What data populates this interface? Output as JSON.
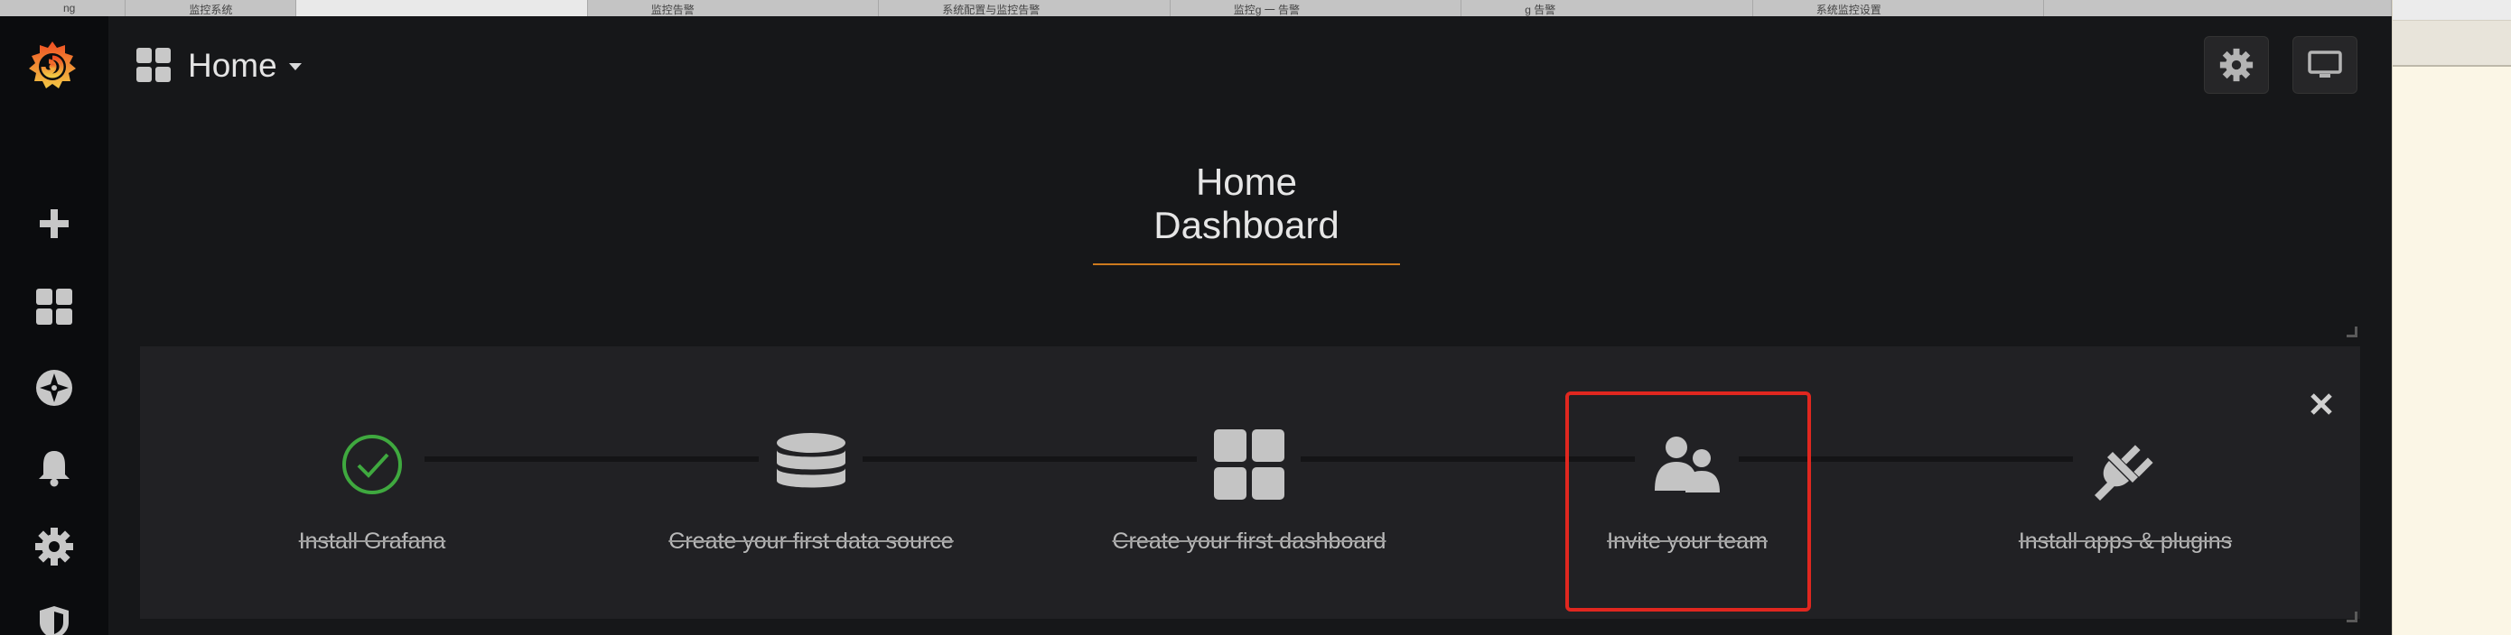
{
  "browser": {
    "tabs": [
      {
        "label": "ng"
      },
      {
        "label": "监控系统"
      },
      {
        "label": ""
      },
      {
        "label": "监控告警"
      },
      {
        "label": "系统配置与监控告警"
      },
      {
        "label": "监控g  一  告警"
      },
      {
        "label": "g    告警"
      },
      {
        "label": "系统监控设置"
      },
      {
        "label": ""
      }
    ]
  },
  "sidebar": {
    "items": [
      {
        "icon": "plus-icon",
        "label": "Create"
      },
      {
        "icon": "dashboards-icon",
        "label": "Dashboards"
      },
      {
        "icon": "explore-compass-icon",
        "label": "Explore"
      },
      {
        "icon": "bell-icon",
        "label": "Alerting"
      },
      {
        "icon": "gear-icon",
        "label": "Configuration"
      },
      {
        "icon": "shield-icon",
        "label": "Server Admin"
      }
    ]
  },
  "navbar": {
    "title": "Home",
    "actions": [
      {
        "icon": "gear-icon",
        "label": "Dashboard settings"
      },
      {
        "icon": "monitor-icon",
        "label": "Cycle view mode"
      }
    ]
  },
  "dashboard": {
    "title": "Home Dashboard"
  },
  "getting_started": {
    "steps": [
      {
        "label": "Install Grafana",
        "icon": "check-circle-icon",
        "done": true
      },
      {
        "label": "Create your first data source",
        "icon": "database-icon",
        "done": true
      },
      {
        "label": "Create your first dashboard",
        "icon": "dashboard-grid-icon",
        "done": true
      },
      {
        "label": "Invite your team",
        "icon": "users-icon",
        "done": true
      },
      {
        "label": "Install apps & plugins",
        "icon": "plug-icon",
        "done": true
      }
    ],
    "close_label": "×"
  },
  "colors": {
    "accent_orange": "#eb7b18",
    "highlight_red": "#e0271f",
    "check_green": "#3fa93f",
    "panel_bg": "#212124",
    "sidebar_bg": "#0b0c0e"
  }
}
